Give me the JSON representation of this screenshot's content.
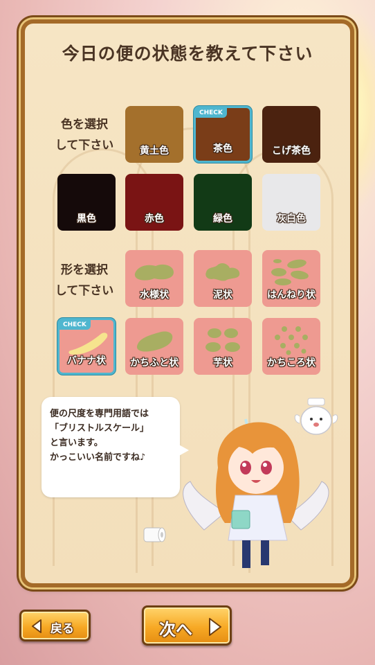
{
  "title": "今日の便の状態を教えて下さい",
  "color_section": {
    "label_line1": "色を選択",
    "label_line2": "して下さい",
    "options": [
      {
        "label": "黄土色",
        "color": "#a4702c",
        "selected": false
      },
      {
        "label": "茶色",
        "color": "#7a3d18",
        "selected": true,
        "check": "CHECK"
      },
      {
        "label": "こげ茶色",
        "color": "#4b220f",
        "selected": false
      },
      {
        "label": "黒色",
        "color": "#150a0a",
        "selected": false
      },
      {
        "label": "赤色",
        "color": "#7a1414",
        "selected": false
      },
      {
        "label": "緑色",
        "color": "#123a16",
        "selected": false
      },
      {
        "label": "灰白色",
        "color": "#e8e8ea",
        "selected": false
      }
    ]
  },
  "shape_section": {
    "label_line1": "形を選択",
    "label_line2": "して下さい",
    "options": [
      {
        "label": "水様状",
        "icon": "watery-stool-icon",
        "selected": false
      },
      {
        "label": "泥状",
        "icon": "mushy-stool-icon",
        "selected": false
      },
      {
        "label": "はんねり状",
        "icon": "soft-blobs-icon",
        "selected": false
      },
      {
        "label": "バナナ状",
        "icon": "banana-stool-icon",
        "selected": true,
        "check": "CHECK"
      },
      {
        "label": "かちふと状",
        "icon": "hard-thick-stool-icon",
        "selected": false
      },
      {
        "label": "芋状",
        "icon": "lumpy-stool-icon",
        "selected": false
      },
      {
        "label": "かちころ状",
        "icon": "pellet-stool-icon",
        "selected": false
      }
    ]
  },
  "bubble": {
    "line1": "便の尺度を専門用語では",
    "line2": "「ブリストルスケール」",
    "line3": "と言います。",
    "line4": "かっこいい名前ですね♪"
  },
  "nav": {
    "back_label": "戻る",
    "next_label": "次へ"
  },
  "colors": {
    "accent": "#f7a925",
    "check": "#4fb6cf",
    "shape_tile": "#ee9a91",
    "stool_icon": "#a8ae62"
  }
}
